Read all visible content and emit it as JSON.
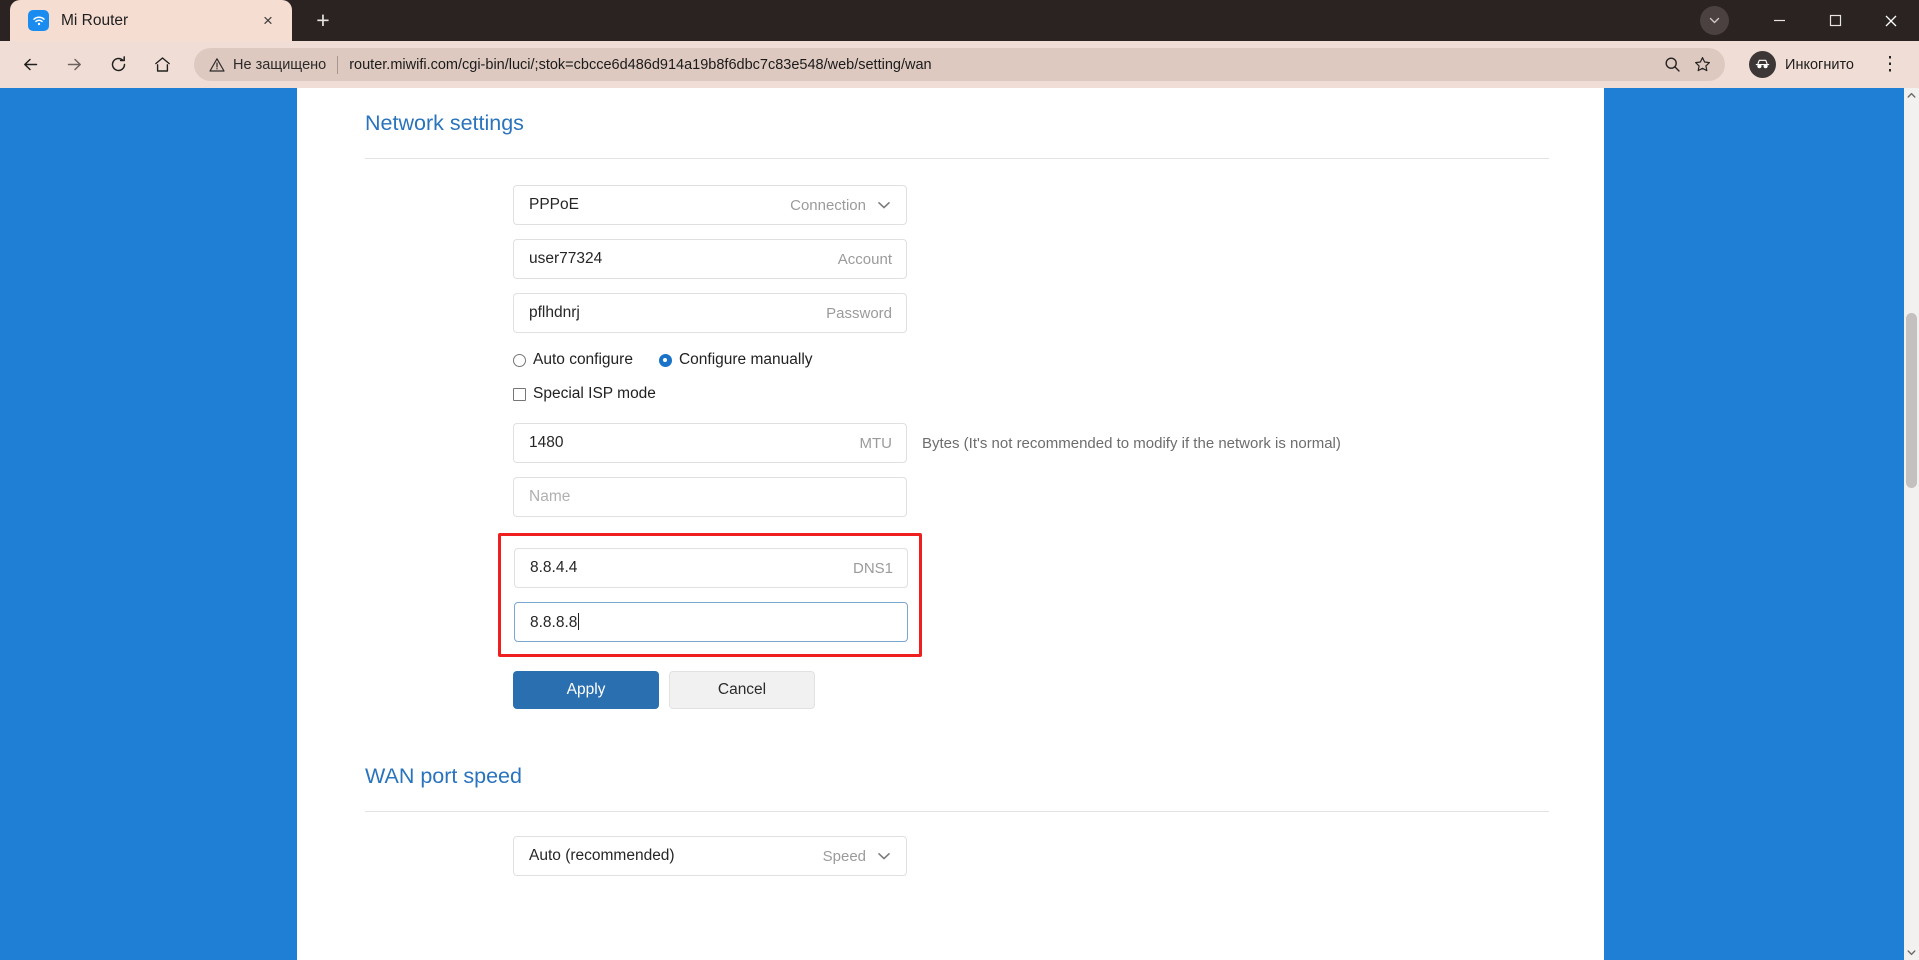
{
  "browser": {
    "tab": {
      "title": "Mi Router",
      "favicon": "wifi-icon",
      "close": "×"
    },
    "new_tab_label": "+",
    "nav": {
      "back": "←",
      "forward": "→",
      "reload": "⟳",
      "home": "⌂"
    },
    "omnibox": {
      "security_label": "Не защищено",
      "url": "router.miwifi.com/cgi-bin/luci/;stok=cbcce6d486d914a19b8f6dbc7c83e548/web/setting/wan",
      "search_icon": "search-icon",
      "bookmark_icon": "star-icon"
    },
    "profile": {
      "label": "Инкогнито"
    },
    "menu_label": "⋮",
    "window_controls": {
      "minimize": "—",
      "maximize": "❐",
      "close": "✕",
      "extension": "▼"
    }
  },
  "page": {
    "network_settings": {
      "title": "Network settings",
      "connection": {
        "value": "PPPoE",
        "label": "Connection"
      },
      "account": {
        "value": "user77324",
        "label": "Account"
      },
      "password": {
        "value": "pflhdnrj",
        "label": "Password"
      },
      "radios": [
        {
          "label": "Auto configure",
          "checked": false
        },
        {
          "label": "Configure manually",
          "checked": true
        }
      ],
      "checkbox": {
        "label": "Special ISP mode",
        "checked": false
      },
      "mtu": {
        "value": "1480",
        "label": "MTU",
        "hint": "Bytes (It's not recommended to modify if the network is normal)"
      },
      "name": {
        "value": "",
        "placeholder": "Name",
        "label": ""
      },
      "dns1": {
        "value": "8.8.4.4",
        "label": "DNS1"
      },
      "dns2": {
        "value": "8.8.8.8",
        "label": ""
      },
      "apply_label": "Apply",
      "cancel_label": "Cancel",
      "highlight_color": "#ef1f1f"
    },
    "wan_port_speed": {
      "title": "WAN port speed",
      "speed": {
        "value": "Auto (recommended)",
        "label": "Speed"
      }
    },
    "accent_color": "#2a73bd",
    "background_color": "#1e7fd4"
  }
}
